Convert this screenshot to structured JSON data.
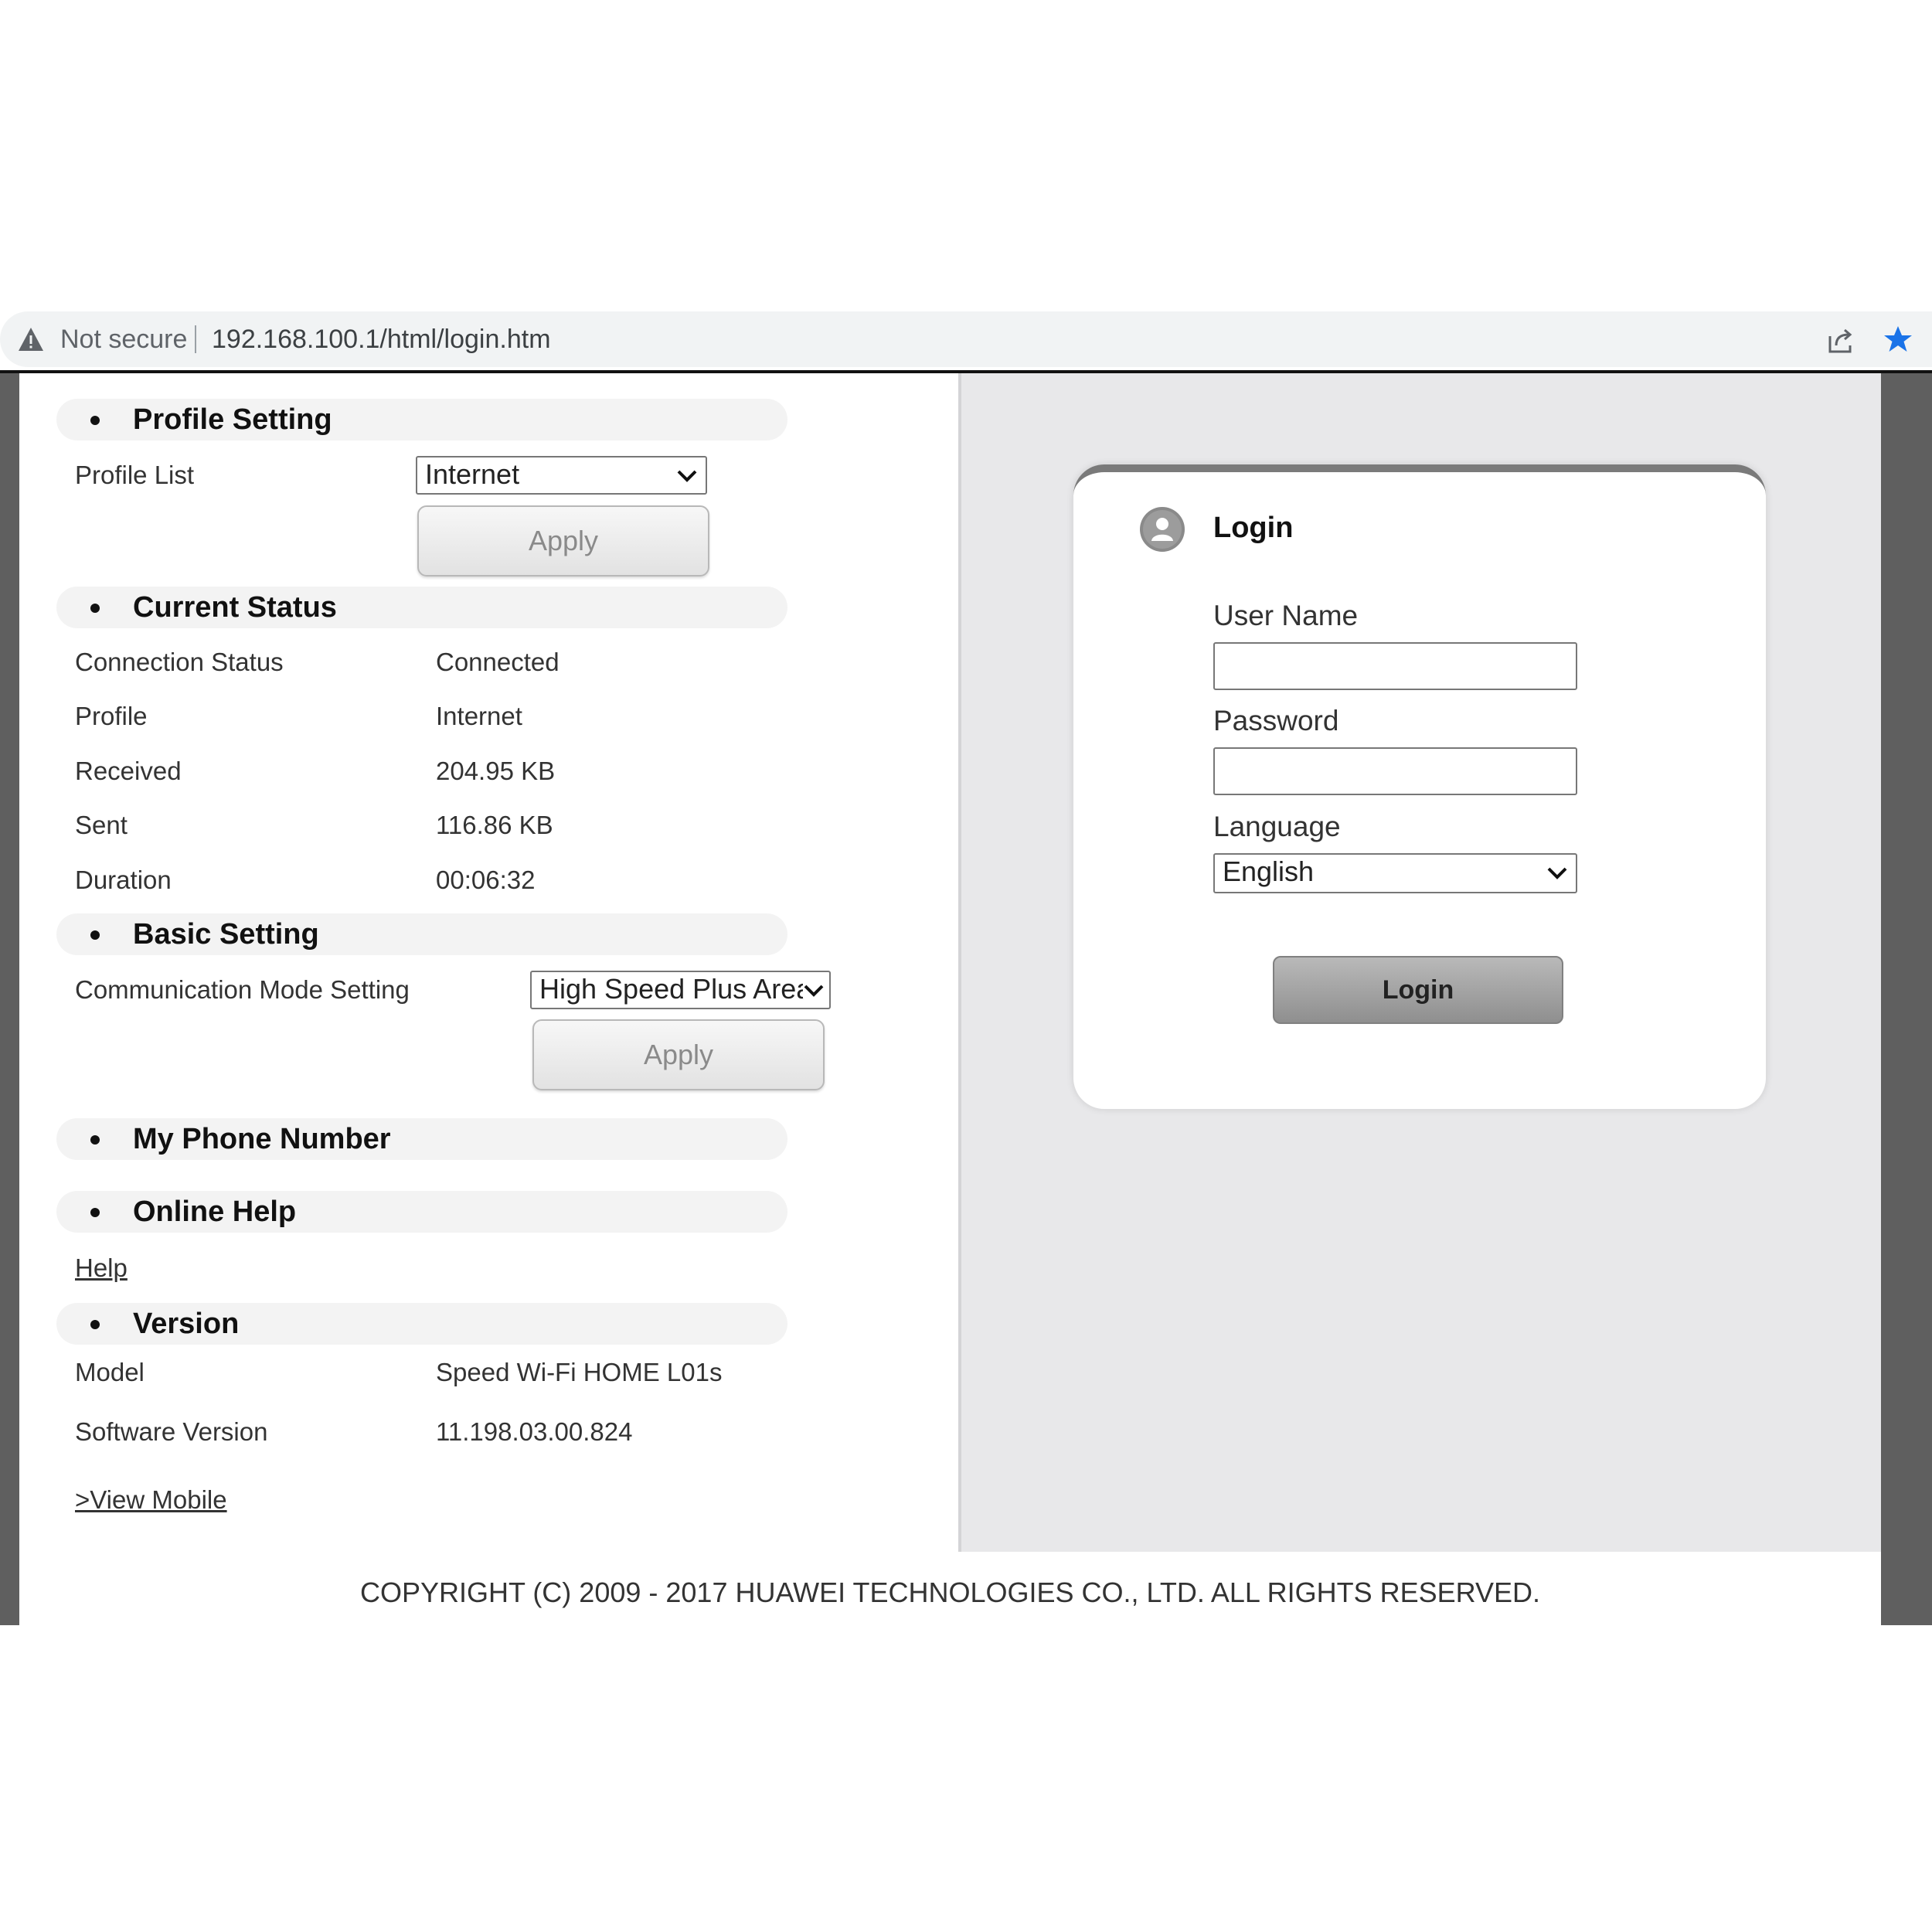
{
  "browser": {
    "security_label": "Not secure",
    "url": "192.168.100.1/html/login.htm",
    "icons": {
      "warning": "warning-triangle-icon",
      "share": "share-icon",
      "bookmark": "star-icon"
    },
    "bookmark_color": "#1a73e8"
  },
  "profile_setting": {
    "title": "Profile Setting",
    "profile_list_label": "Profile List",
    "profile_selected": "Internet",
    "apply_label": "Apply"
  },
  "current_status": {
    "title": "Current Status",
    "rows": [
      {
        "label": "Connection Status",
        "value": "Connected"
      },
      {
        "label": "Profile",
        "value": "Internet"
      },
      {
        "label": "Received",
        "value": "204.95 KB"
      },
      {
        "label": "Sent",
        "value": "116.86 KB"
      },
      {
        "label": "Duration",
        "value": "00:06:32"
      }
    ]
  },
  "basic_setting": {
    "title": "Basic Setting",
    "mode_label": "Communication Mode Setting",
    "mode_selected": "High Speed Plus Area",
    "apply_label": "Apply"
  },
  "my_phone_number": {
    "title": "My Phone Number"
  },
  "online_help": {
    "title": "Online Help",
    "help_link": "Help"
  },
  "version": {
    "title": "Version",
    "rows": [
      {
        "label": "Model",
        "value": "Speed Wi-Fi HOME L01s"
      },
      {
        "label": "Software Version",
        "value": "11.198.03.00.824"
      }
    ],
    "view_mobile_link": ">View Mobile"
  },
  "login": {
    "title": "Login",
    "username_label": "User Name",
    "username_value": "",
    "password_label": "Password",
    "password_value": "",
    "language_label": "Language",
    "language_selected": "English",
    "login_button": "Login"
  },
  "footer": {
    "copyright": "COPYRIGHT (C) 2009 - 2017 HUAWEI TECHNOLOGIES CO., LTD. ALL RIGHTS RESERVED."
  }
}
